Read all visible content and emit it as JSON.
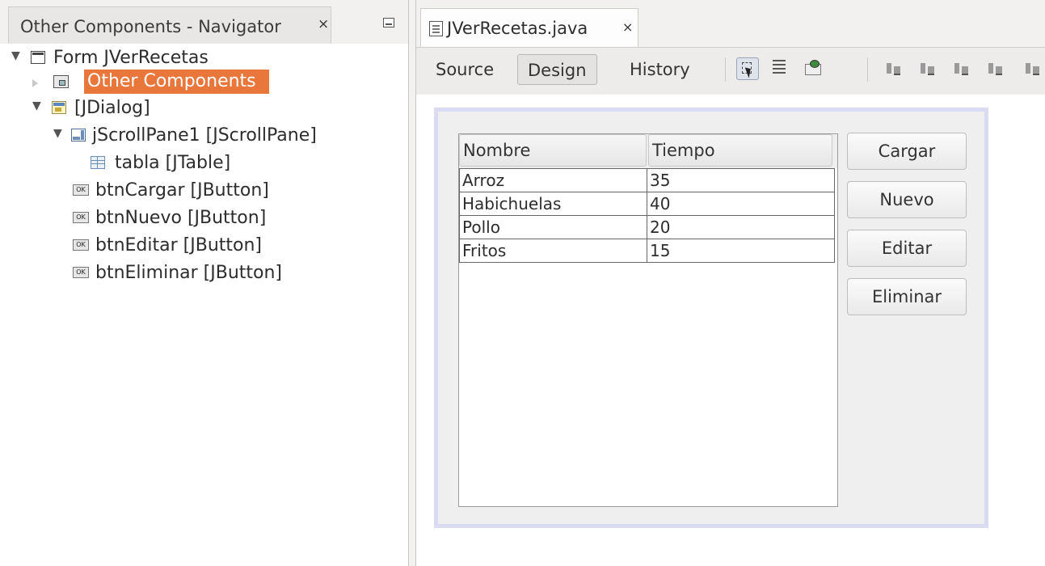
{
  "navigator": {
    "tab_title": "Other Components - Navigator",
    "close_glyph": "×",
    "tree": {
      "form": "Form JVerRecetas",
      "other_components": "Other Components",
      "dialog": "[JDialog]",
      "scroll_pane": "jScrollPane1 [JScrollPane]",
      "table": "tabla [JTable]",
      "buttons": [
        "btnCargar [JButton]",
        "btnNuevo [JButton]",
        "btnEditar [JButton]",
        "btnEliminar [JButton]"
      ],
      "ok_icon_text": "OK"
    }
  },
  "editor": {
    "file_tab": "JVerRecetas.java",
    "close_glyph": "×",
    "toolbar": {
      "source": "Source",
      "design": "Design",
      "history": "History"
    },
    "table": {
      "columns": [
        "Nombre",
        "Tiempo"
      ],
      "rows": [
        [
          "Arroz",
          "35"
        ],
        [
          "Habichuelas",
          "40"
        ],
        [
          "Pollo",
          "20"
        ],
        [
          "Fritos",
          "15"
        ]
      ]
    },
    "buttons": {
      "cargar": "Cargar",
      "nuevo": "Nuevo",
      "editar": "Editar",
      "eliminar": "Eliminar"
    }
  },
  "colors": {
    "selection": "#e9773c",
    "form_border": "#d9dbf2"
  }
}
